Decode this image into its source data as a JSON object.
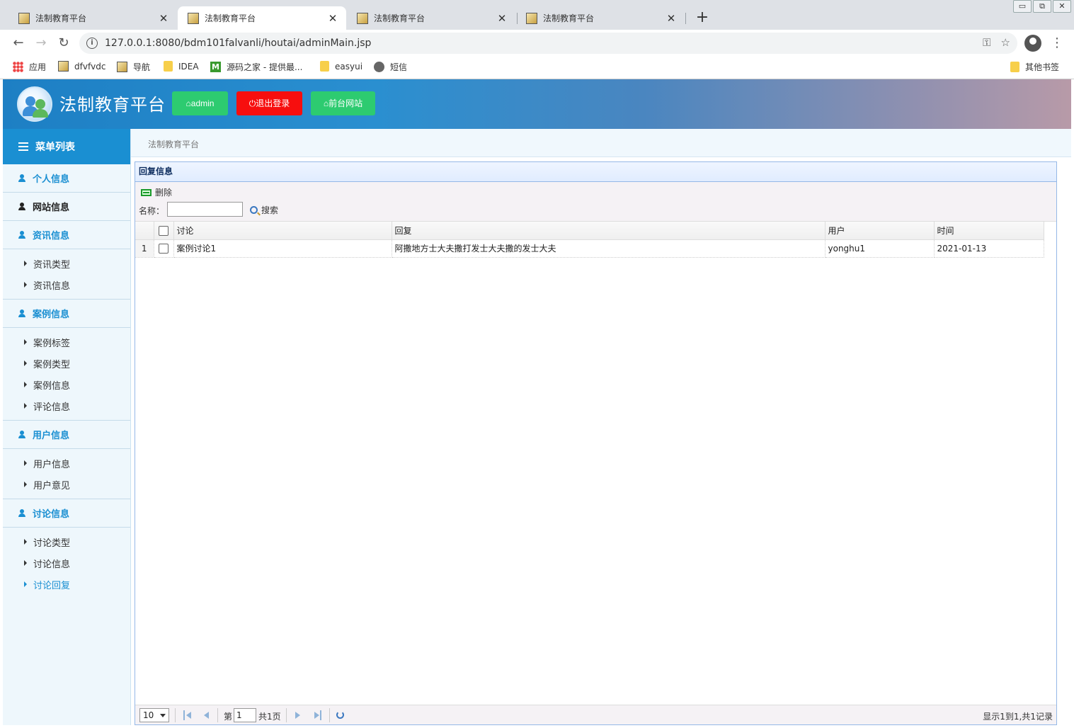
{
  "browser": {
    "tabs": [
      {
        "title": "法制教育平台"
      },
      {
        "title": "法制教育平台"
      },
      {
        "title": "法制教育平台"
      },
      {
        "title": "法制教育平台"
      }
    ],
    "url": "127.0.0.1:8080/bdm101falvanli/houtai/adminMain.jsp",
    "bookmarks": [
      "应用",
      "dfvfvdc",
      "导航",
      "IDEA",
      "源码之家 - 提供最...",
      "easyui",
      "短信"
    ],
    "other_bookmarks": "其他书签"
  },
  "header": {
    "title": "法制教育平台",
    "admin_label": "admin",
    "logout_label": "退出登录",
    "frontend_label": "前台网站"
  },
  "sidebar": {
    "menu_title": "菜单列表",
    "groups": [
      {
        "label": "个人信息",
        "items": []
      },
      {
        "label": "网站信息",
        "items": []
      },
      {
        "label": "资讯信息",
        "items": [
          "资讯类型",
          "资讯信息"
        ]
      },
      {
        "label": "案例信息",
        "items": [
          "案例标签",
          "案例类型",
          "案例信息",
          "评论信息"
        ]
      },
      {
        "label": "用户信息",
        "items": [
          "用户信息",
          "用户意见"
        ]
      },
      {
        "label": "讨论信息",
        "items": [
          "讨论类型",
          "讨论信息",
          "讨论回复"
        ]
      }
    ],
    "active_item": "讨论回复"
  },
  "breadcrumb": "法制教育平台",
  "panel": {
    "title": "回复信息",
    "delete_label": "删除",
    "search_label": "名称：",
    "search_value": "",
    "search_button": "搜索",
    "columns": [
      "讨论",
      "回复",
      "用户",
      "时间"
    ],
    "rows": [
      {
        "num": "1",
        "discussion": "案例讨论1",
        "reply": "阿撒地方士大夫撒打发士大夫撒的发士大夫",
        "user": "yonghu1",
        "time": "2021-01-13"
      }
    ],
    "pager": {
      "page_size": "10",
      "page_prefix": "第",
      "page_value": "1",
      "page_total": "共1页",
      "info": "显示1到1,共1记录"
    }
  }
}
